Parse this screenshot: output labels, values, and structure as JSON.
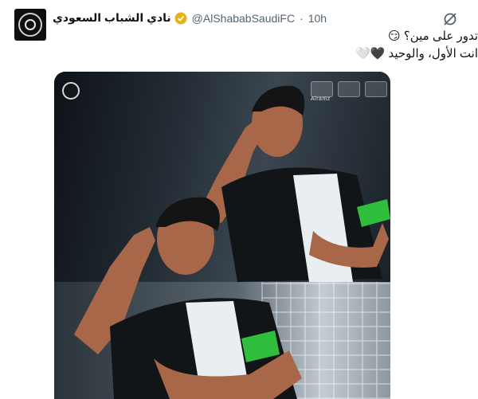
{
  "tweet": {
    "display_name": "نادي الشباب السعودي",
    "handle": "@AlShababSaudiFC",
    "separator": "·",
    "time": "10h",
    "text_line1": "تدور على مين؟ 😏",
    "text_line2": "انت الأول، والوحيد 🖤🤍"
  },
  "media": {
    "sponsor_name": "Alramz"
  },
  "colors": {
    "verified_badge": "#e8b11c",
    "armband": "#2fbf3d",
    "handle_gray": "#536471"
  },
  "icons": {
    "verified": "verified-badge-icon",
    "more": "grok-explain-icon"
  }
}
